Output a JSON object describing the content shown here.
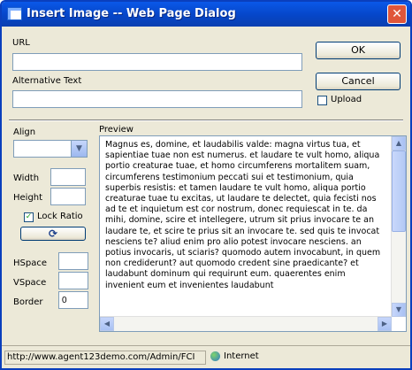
{
  "window": {
    "title": "Insert Image -- Web Page Dialog",
    "close_glyph": "✕"
  },
  "url": {
    "label": "URL",
    "value": ""
  },
  "alt_text": {
    "label": "Alternative Text",
    "value": ""
  },
  "buttons": {
    "ok": "OK",
    "cancel": "Cancel",
    "upload": "Upload",
    "refresh_glyph": "⟳"
  },
  "align": {
    "label": "Align",
    "selected": ""
  },
  "width": {
    "label": "Width",
    "value": ""
  },
  "height": {
    "label": "Height",
    "value": ""
  },
  "lock_ratio": {
    "label": "Lock Ratio",
    "checked": true,
    "check_glyph": "✓"
  },
  "hspace": {
    "label": "HSpace",
    "value": ""
  },
  "vspace": {
    "label": "VSpace",
    "value": ""
  },
  "border": {
    "label": "Border",
    "value": "0"
  },
  "preview": {
    "label": "Preview",
    "text": "Magnus es, domine, et laudabilis valde: magna virtus tua, et sapientiae tuae non est numerus. et laudare te vult homo, aliqua portio creaturae tuae, et homo circumferens mortalitem suam, circumferens testimonium peccati sui et testimonium, quia superbis resistis: et tamen laudare te vult homo, aliqua portio creaturae tuae tu excitas, ut laudare te delectet, quia fecisti nos ad te et inquietum est cor nostrum, donec requiescat in te. da mihi, domine, scire et intellegere, utrum sit prius invocare te an laudare te, et scire te prius sit an invocare te. sed quis te invocat nesciens te? aliud enim pro alio potest invocare nesciens. an potius invocaris, ut sciaris? quomodo autem invocabunt, in quem non crediderunt? aut quomodo credent sine praedicante? et laudabunt dominum qui requirunt eum. quaerentes enim invenient eum et invenientes laudabunt"
  },
  "status": {
    "url": "http://www.agent123demo.com/Admin/FCI",
    "zone": "Internet"
  },
  "colors": {
    "titlebar": "#0a58e8",
    "dialog_bg": "#ece9d8",
    "close_button": "#e0563a"
  }
}
